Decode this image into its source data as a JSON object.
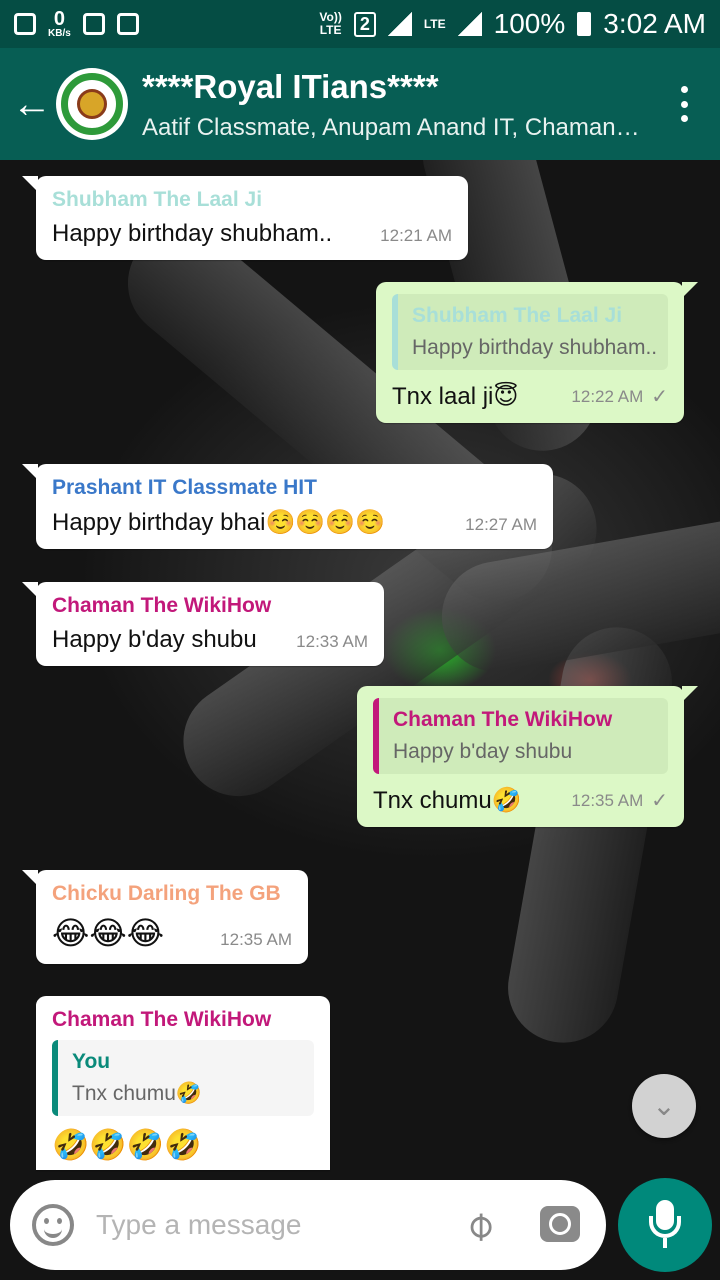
{
  "status_bar": {
    "kbs_value": "0",
    "kbs_unit": "KB/s",
    "volte": "Vo))\nLTE",
    "sim": "2",
    "network": "LTE",
    "battery": "100%",
    "time": "3:02 AM"
  },
  "header": {
    "back_icon": "arrow-left-icon",
    "title": "****Royal ITians****",
    "members": "Aatif Classmate, Anupam Anand IT, Chaman The WikiHow"
  },
  "messages": [
    {
      "sender": "Shubham The Laal Ji",
      "sender_color": "#a8dfd8",
      "text": "Happy birthday shubham..",
      "time": "12:21 AM"
    },
    {
      "quote_sender": "Shubham The Laal Ji",
      "quote_color": "#a8dfd8",
      "quote_text": "Happy birthday shubham..",
      "text": "Tnx laal ji😇",
      "time": "12:22 AM",
      "status": "✓"
    },
    {
      "sender": "Prashant IT Classmate HIT",
      "sender_color": "#3a78c9",
      "text": "Happy birthday bhai☺️☺️☺️☺️",
      "time": "12:27 AM"
    },
    {
      "sender": "Chaman The WikiHow",
      "sender_color": "#c2187a",
      "text": "Happy b'day shubu",
      "time": "12:33 AM"
    },
    {
      "quote_sender": "Chaman The WikiHow",
      "quote_color": "#c2187a",
      "quote_text": "Happy b'day shubu",
      "text": "Tnx chumu🤣",
      "time": "12:35 AM",
      "status": "✓"
    },
    {
      "sender": "Chicku Darling The GB",
      "sender_color": "#f4a27c",
      "text": "😂😂😂",
      "time": "12:35 AM"
    },
    {
      "sender": "Chaman The WikiHow",
      "sender_color": "#c2187a",
      "quote_sender": "You",
      "quote_color": "#0a8a7a",
      "quote_text": "Tnx chumu🤣",
      "text": "🤣🤣🤣🤣"
    }
  ],
  "input": {
    "placeholder": "Type a message"
  },
  "colors": {
    "header": "#075e54",
    "status_bar": "#054d44",
    "outgoing": "#dcf8c6",
    "mic": "#00897b"
  }
}
